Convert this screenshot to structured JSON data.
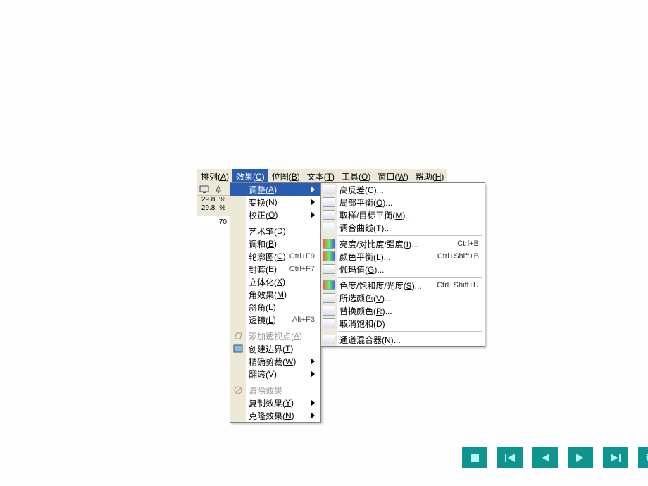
{
  "menubar": {
    "items": [
      {
        "label": "排列",
        "accel": "A"
      },
      {
        "label": "效果",
        "accel": "C"
      },
      {
        "label": "位图",
        "accel": "B"
      },
      {
        "label": "文本",
        "accel": "T"
      },
      {
        "label": "工具",
        "accel": "O"
      },
      {
        "label": "窗口",
        "accel": "W"
      },
      {
        "label": "帮助",
        "accel": "H"
      }
    ]
  },
  "toolbar": {
    "num1": "29.8",
    "pct1": "%",
    "num2": "29.8",
    "pct2": "%",
    "ruler": "70"
  },
  "effects": {
    "items": [
      {
        "label": "调整",
        "accel": "A",
        "sub": true,
        "hl": true
      },
      {
        "label": "变换",
        "accel": "N",
        "sub": true
      },
      {
        "label": "校正",
        "accel": "O",
        "sub": true
      },
      {
        "sep": true
      },
      {
        "label": "艺术笔",
        "accel": "D"
      },
      {
        "label": "调和",
        "accel": "B"
      },
      {
        "label": "轮廓图",
        "accel": "C",
        "sc": "Ctrl+F9"
      },
      {
        "label": "封套",
        "accel": "E",
        "sc": "Ctrl+F7"
      },
      {
        "label": "立体化",
        "accel": "X"
      },
      {
        "label": "角效果",
        "accel": "M"
      },
      {
        "label": "斜角",
        "accel": "L"
      },
      {
        "label": "透镜",
        "accel": "L",
        "sc": "Alt+F3"
      },
      {
        "sep": true
      },
      {
        "label": "添加透视点",
        "accel": "A",
        "disabled": true,
        "ico": "persp"
      },
      {
        "label": "创建边界",
        "accel": "T",
        "ico": "bound"
      },
      {
        "label": "精确剪裁",
        "accel": "W",
        "sub": true
      },
      {
        "label": "翻滚",
        "accel": "V",
        "sub": true
      },
      {
        "sep": true
      },
      {
        "label": "清除效果",
        "disabled": true,
        "ico": "clear"
      },
      {
        "label": "复制效果",
        "accel": "Y",
        "sub": true
      },
      {
        "label": "克隆效果",
        "accel": "N",
        "sub": true
      }
    ]
  },
  "adjust": {
    "items": [
      {
        "label": "高反差",
        "accel": "C",
        "dots": true
      },
      {
        "label": "局部平衡",
        "accel": "O",
        "dots": true
      },
      {
        "label": "取样/目标平衡",
        "accel": "M",
        "dots": true
      },
      {
        "label": "调合曲线",
        "accel": "T",
        "dots": true,
        "cls": "crv"
      },
      {
        "sep": true
      },
      {
        "label": "亮度/对比度/强度",
        "accel": "I",
        "dots": true,
        "sc": "Ctrl+B",
        "cls": "clr"
      },
      {
        "label": "颜色平衡",
        "accel": "L",
        "dots": true,
        "sc": "Ctrl+Shift+B",
        "cls": "clr"
      },
      {
        "label": "伽玛值",
        "accel": "G",
        "dots": true
      },
      {
        "sep": true
      },
      {
        "label": "色度/饱和度/光度",
        "accel": "S",
        "dots": true,
        "sc": "Ctrl+Shift+U",
        "cls": "clr"
      },
      {
        "label": "所选颜色",
        "accel": "V",
        "dots": true
      },
      {
        "label": "替换颜色",
        "accel": "R",
        "dots": true
      },
      {
        "label": "取消饱和",
        "accel": "D"
      },
      {
        "sep": true
      },
      {
        "label": "通道混合器",
        "accel": "N",
        "dots": true
      }
    ]
  }
}
